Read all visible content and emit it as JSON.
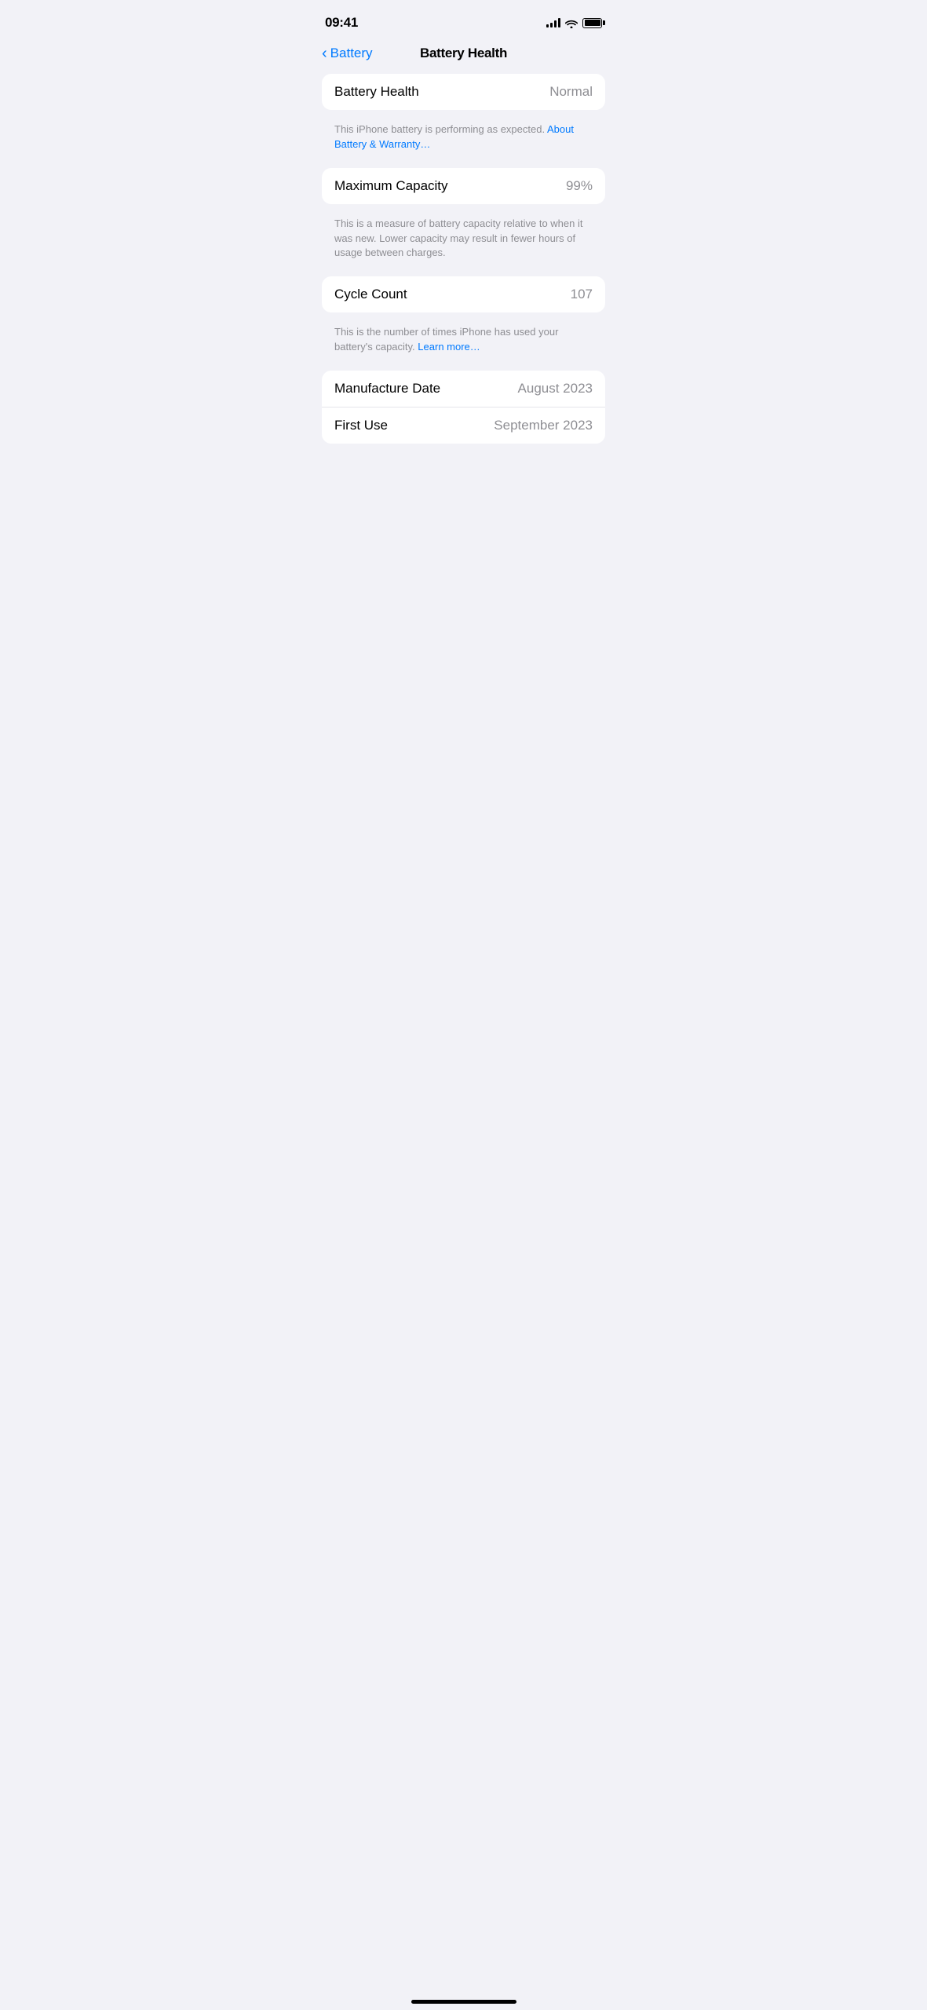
{
  "statusBar": {
    "time": "09:41",
    "battery": "full"
  },
  "navigation": {
    "backLabel": "Battery",
    "title": "Battery Health"
  },
  "sections": [
    {
      "id": "battery-health-section",
      "rows": [
        {
          "label": "Battery Health",
          "value": "Normal"
        }
      ],
      "description": "This iPhone battery is performing as expected.",
      "linkText": "About Battery & Warranty…",
      "hasLink": true
    },
    {
      "id": "maximum-capacity-section",
      "rows": [
        {
          "label": "Maximum Capacity",
          "value": "99%"
        }
      ],
      "description": "This is a measure of battery capacity relative to when it was new. Lower capacity may result in fewer hours of usage between charges.",
      "hasLink": false
    },
    {
      "id": "cycle-count-section",
      "rows": [
        {
          "label": "Cycle Count",
          "value": "107"
        }
      ],
      "description": "This is the number of times iPhone has used your battery's capacity.",
      "linkText": "Learn more…",
      "hasLink": true
    },
    {
      "id": "dates-section",
      "rows": [
        {
          "label": "Manufacture Date",
          "value": "August 2023"
        },
        {
          "label": "First Use",
          "value": "September 2023"
        }
      ],
      "hasLink": false
    }
  ]
}
